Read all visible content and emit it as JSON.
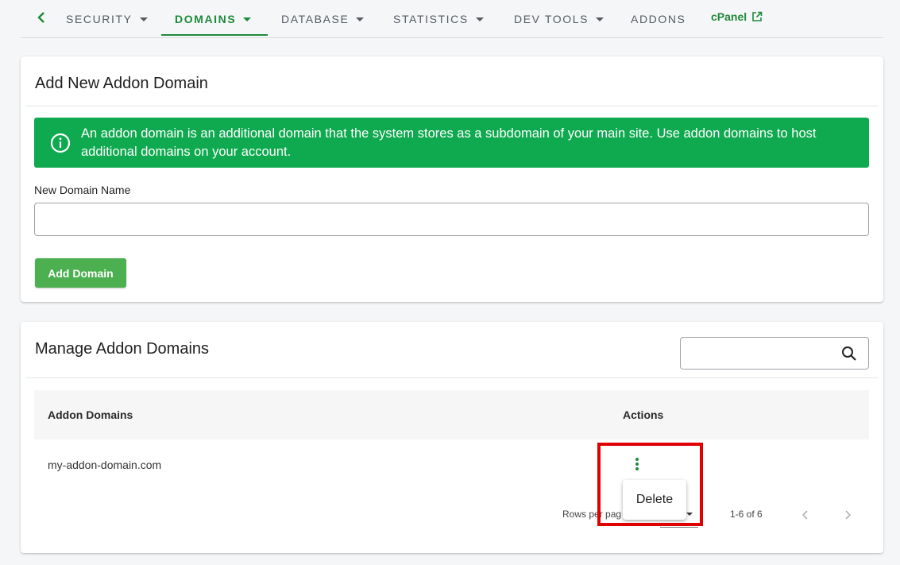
{
  "nav": {
    "tabs": [
      {
        "label": "SECURITY"
      },
      {
        "label": "DOMAINS"
      },
      {
        "label": "DATABASE"
      },
      {
        "label": "STATISTICS"
      },
      {
        "label": "DEV TOOLS"
      },
      {
        "label": "ADDONS"
      }
    ],
    "active_tab": "DOMAINS",
    "cpanel_label": "cPanel",
    "accent_color": "#1e8a3a"
  },
  "add_card": {
    "title": "Add New Addon Domain",
    "info_text": "An addon domain is an additional domain that the system stores as a subdomain of your main site. Use addon domains to host additional domains on your account.",
    "info_color": "#0fa94f",
    "field_label": "New Domain Name",
    "field_value": "",
    "button_label": "Add Domain",
    "button_color": "#4caf50"
  },
  "manage_card": {
    "title": "Manage Addon Domains",
    "search_value": "",
    "columns": [
      "Addon Domains",
      "Actions"
    ],
    "rows": [
      {
        "domain": "my-addon-domain.com"
      }
    ],
    "rows_per_page_label": "Rows per pag",
    "page_range": "1-6 of 6",
    "menu_item": "Delete"
  },
  "highlight_color": "#e00000"
}
